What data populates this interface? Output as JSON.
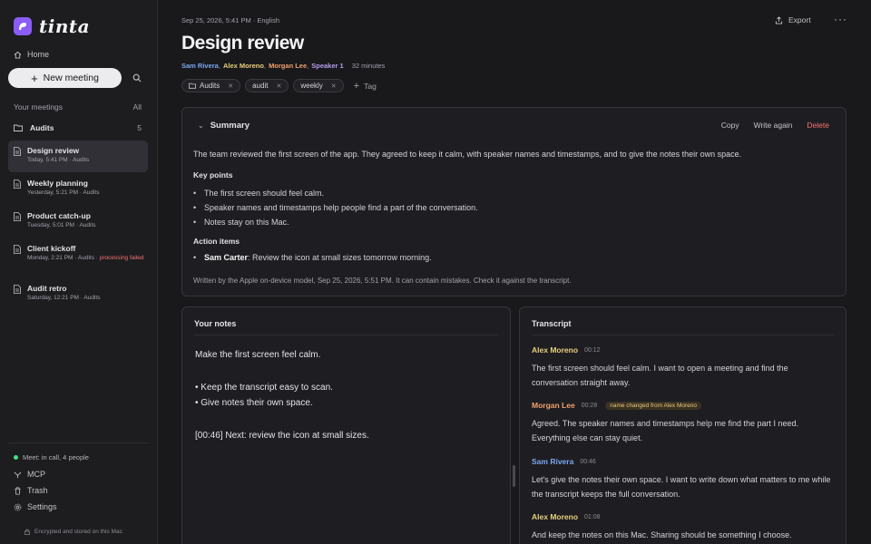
{
  "app": {
    "name": "tinta"
  },
  "sidebar": {
    "home_label": "Home",
    "new_meeting_label": "New meeting",
    "your_meetings_label": "Your meetings",
    "all_label": "All",
    "folder": {
      "label": "Audits",
      "count": "5"
    },
    "meetings": [
      {
        "title": "Design review",
        "sub": "Today, 5:41 PM · Audits",
        "active": true
      },
      {
        "title": "Weekly planning",
        "sub": "Yesterday, 5:21 PM · Audits"
      },
      {
        "title": "Product catch-up",
        "sub": "Tuesday, 5:01 PM · Audits"
      },
      {
        "title": "Client kickoff",
        "sub": "Monday, 2:21 PM · Audits · ",
        "warn": "processing failed"
      },
      {
        "title": "Audit retro",
        "sub": "Saturday, 12:21 PM · Audits"
      }
    ],
    "status": "Meet: in call, 4 people",
    "mcp_label": "MCP",
    "trash_label": "Trash",
    "settings_label": "Settings",
    "footer": "Encrypted and stored on this Mac"
  },
  "header": {
    "meta": "Sep 25, 2026, 5:41 PM · English",
    "export_label": "Export",
    "more_label": "···",
    "title": "Design review",
    "participants": [
      "Sam Rivera",
      "Alex Moreno",
      "Morgan Lee",
      "Speaker 1"
    ],
    "duration": "32 minutes",
    "tags": [
      "Audits",
      "audit",
      "weekly"
    ],
    "add_tag_label": "Tag"
  },
  "summary": {
    "heading": "Summary",
    "copy_label": "Copy",
    "write_again_label": "Write again",
    "delete_label": "Delete",
    "text": "The team reviewed the first screen of the app. They agreed to keep it calm, with speaker names and timestamps, and to give the notes their own space.",
    "key_points_label": "Key points",
    "key_points": [
      "The first screen should feel calm.",
      "Speaker names and timestamps help people find a part of the conversation.",
      "Notes stay on this Mac."
    ],
    "action_items_label": "Action items",
    "action_owner": "Sam Carter",
    "action_text": ": Review the icon at small sizes tomorrow morning.",
    "written_by": "Written by the Apple on-device model, Sep 25, 2026, 5:51 PM. It can contain mistakes. Check it against the transcript."
  },
  "notes": {
    "heading": "Your notes",
    "line1": "Make the first screen feel calm.",
    "bullet1": "• Keep the transcript easy to scan.",
    "bullet2": "• Give notes their own space.",
    "line2": "[00:46] Next: review the icon at small sizes."
  },
  "transcript": {
    "heading": "Transcript",
    "segments": [
      {
        "speaker": "Alex Moreno",
        "time": "00:12",
        "text": "The first screen should feel calm. I want to open a meeting and find the conversation straight away."
      },
      {
        "speaker": "Morgan Lee",
        "time": "00:28",
        "badge": "name changed from Alex Moreno",
        "text": "Agreed. The speaker names and timestamps help me find the part I need. Everything else can stay quiet."
      },
      {
        "speaker": "Sam Rivera",
        "time": "00:46",
        "text": "Let's give the notes their own space. I want to write down what matters to me while the transcript keeps the full conversation."
      },
      {
        "speaker": "Alex Moreno",
        "time": "01:08",
        "text": "And keep the notes on this Mac. Sharing should be something I choose."
      }
    ]
  },
  "colors": {
    "accent": "#8b5cf6",
    "alex": "#e8d07a",
    "morgan": "#f0a06a",
    "sam": "#7aa7f0",
    "speaker1": "#b59cf2",
    "danger": "#f87171",
    "online": "#4ade80"
  }
}
